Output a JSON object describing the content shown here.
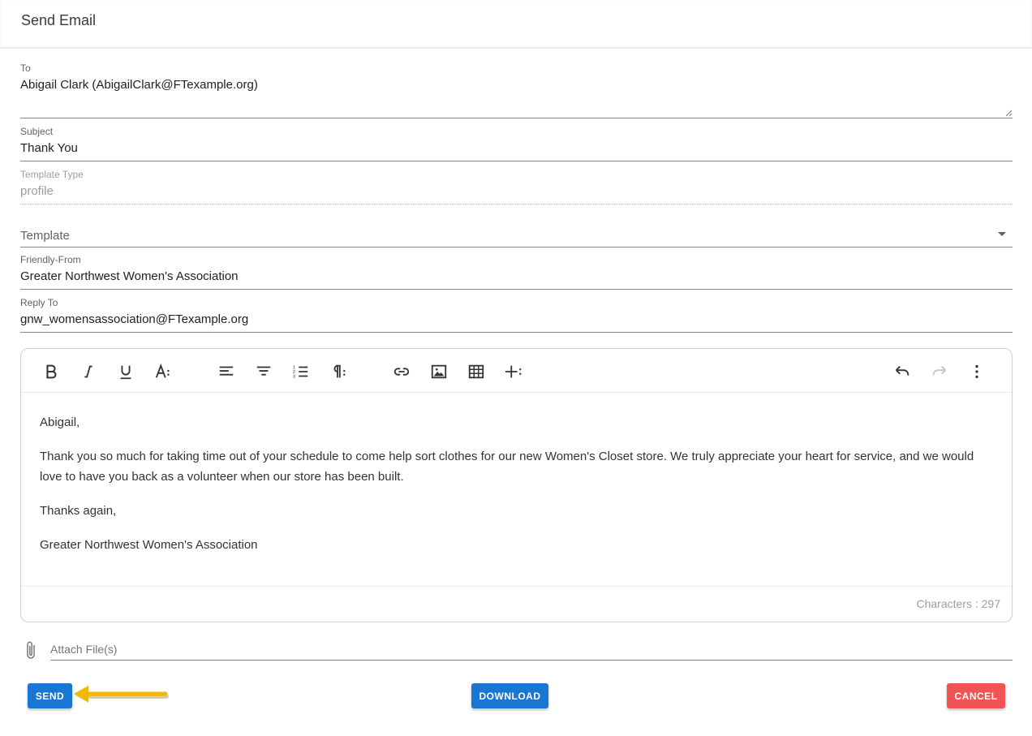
{
  "header": {
    "title": "Send Email"
  },
  "fields": {
    "to": {
      "label": "To",
      "value": "Abigail Clark (AbigailClark@FTexample.org)"
    },
    "subject": {
      "label": "Subject",
      "value": "Thank You"
    },
    "template_type": {
      "label": "Template Type",
      "value": "profile"
    },
    "template": {
      "placeholder": "Template"
    },
    "friendly_from": {
      "label": "Friendly-From",
      "value": "Greater Northwest Women's Association"
    },
    "reply_to": {
      "label": "Reply To",
      "value": "gnw_womensassociation@FTexample.org"
    }
  },
  "editor": {
    "toolbar_icons": [
      "bold-icon",
      "italic-icon",
      "underline-icon",
      "font-size-icon",
      "align-left-icon",
      "align-center-icon",
      "ordered-list-icon",
      "paragraph-format-icon",
      "link-icon",
      "image-icon",
      "table-icon",
      "insert-more-icon",
      "undo-icon",
      "redo-icon",
      "more-vertical-icon"
    ],
    "body": [
      "Abigail,",
      "Thank you so much for taking time out of your schedule to come help sort clothes for our new Women's Closet store. We truly appreciate your heart for service, and we would love to have you back as a volunteer when our store has been built.",
      "Thanks again,",
      "Greater Northwest Women's Association"
    ],
    "char_count": "Characters : 297"
  },
  "attach": {
    "placeholder": "Attach File(s)"
  },
  "actions": {
    "send": "SEND",
    "download": "DOWNLOAD",
    "cancel": "CANCEL"
  },
  "colors": {
    "primary": "#1976d2",
    "danger": "#f05454",
    "annotation_arrow": "#f5b800"
  }
}
